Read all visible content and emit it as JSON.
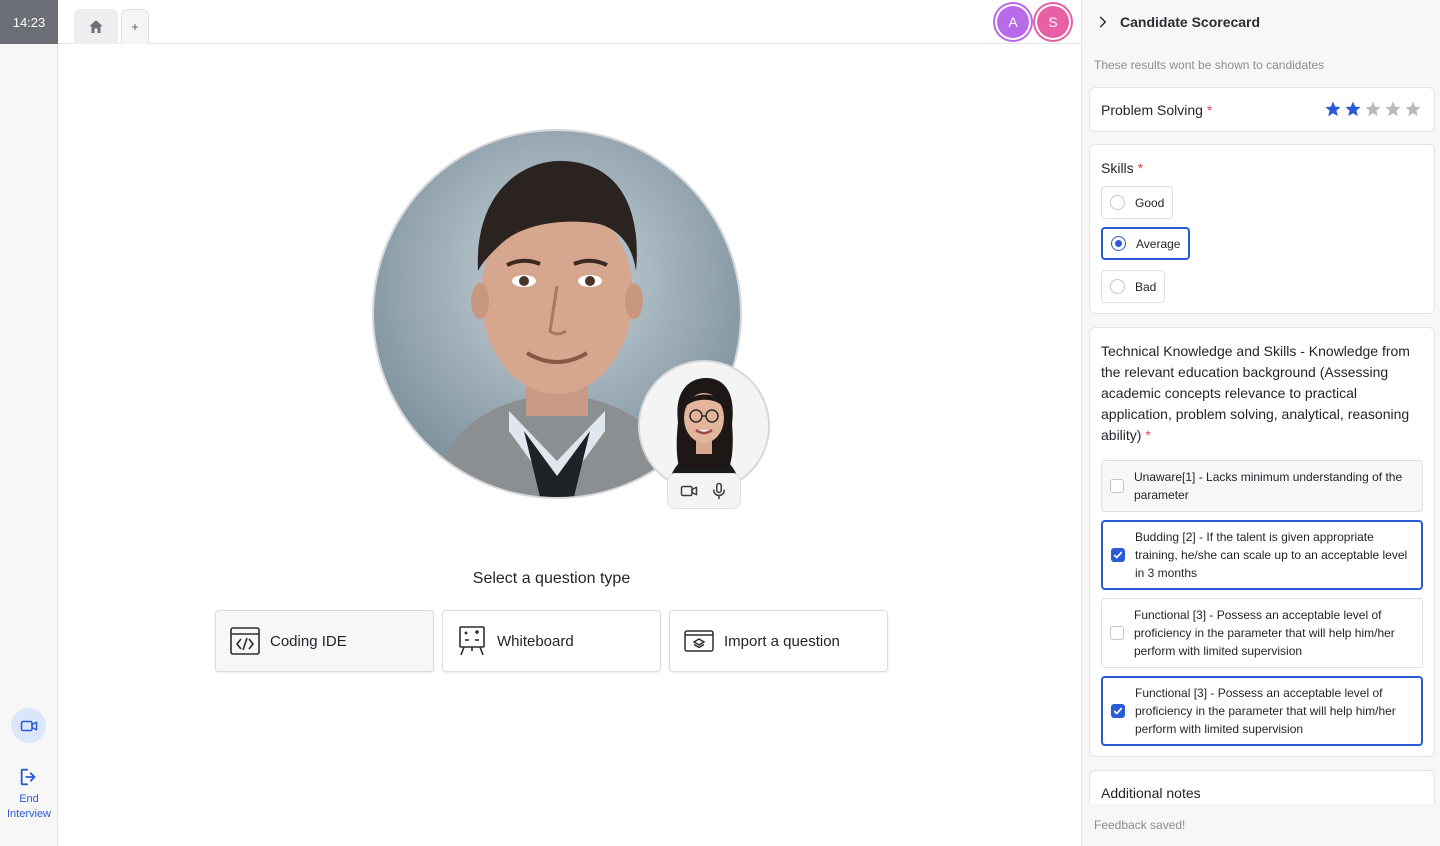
{
  "timer": "14:23",
  "rail": {
    "end_label": "End Interview"
  },
  "tabs": {
    "add_label": "+"
  },
  "participants": [
    {
      "initial": "A",
      "color": "#b86ae8"
    },
    {
      "initial": "S",
      "color": "#e85fa6"
    }
  ],
  "stage": {
    "question_title": "Select a question type",
    "question_types": [
      {
        "label": "Coding IDE",
        "icon": "code-icon"
      },
      {
        "label": "Whiteboard",
        "icon": "whiteboard-icon"
      },
      {
        "label": "Import a question",
        "icon": "import-icon"
      }
    ]
  },
  "scorecard": {
    "title": "Candidate Scorecard",
    "note": "These results wont be shown to candidates",
    "problem_solving": {
      "label": "Problem Solving",
      "required_mark": "*",
      "rating": 2,
      "max_rating": 5
    },
    "skills": {
      "label": "Skills",
      "required_mark": "*",
      "options": [
        "Good",
        "Average",
        "Bad"
      ],
      "selected": "Average"
    },
    "technical": {
      "label": "Technical Knowledge and Skills - Knowledge from the relevant education background (Assessing academic concepts relevance to practical application, problem solving, analytical, reasoning ability)",
      "required_mark": "*",
      "options": [
        {
          "text": "Unaware[1] - Lacks minimum understanding of the parameter",
          "checked": false
        },
        {
          "text": "Budding [2] - If the talent is given appropriate training, he/she can scale up to an acceptable level in 3 months",
          "checked": true
        },
        {
          "text": "Functional [3] - Possess an acceptable level of proficiency in the parameter that will help him/her perform with limited supervision",
          "checked": false
        },
        {
          "text": "Functional [3] - Possess an acceptable level of proficiency in the parameter that will help him/her perform with limited supervision",
          "checked": true
        }
      ]
    },
    "notes_label": "Additional notes",
    "status": "Feedback saved!"
  },
  "colors": {
    "accent": "#2a5bd7",
    "required": "#e5484d",
    "star_empty": "#b8bac0"
  }
}
